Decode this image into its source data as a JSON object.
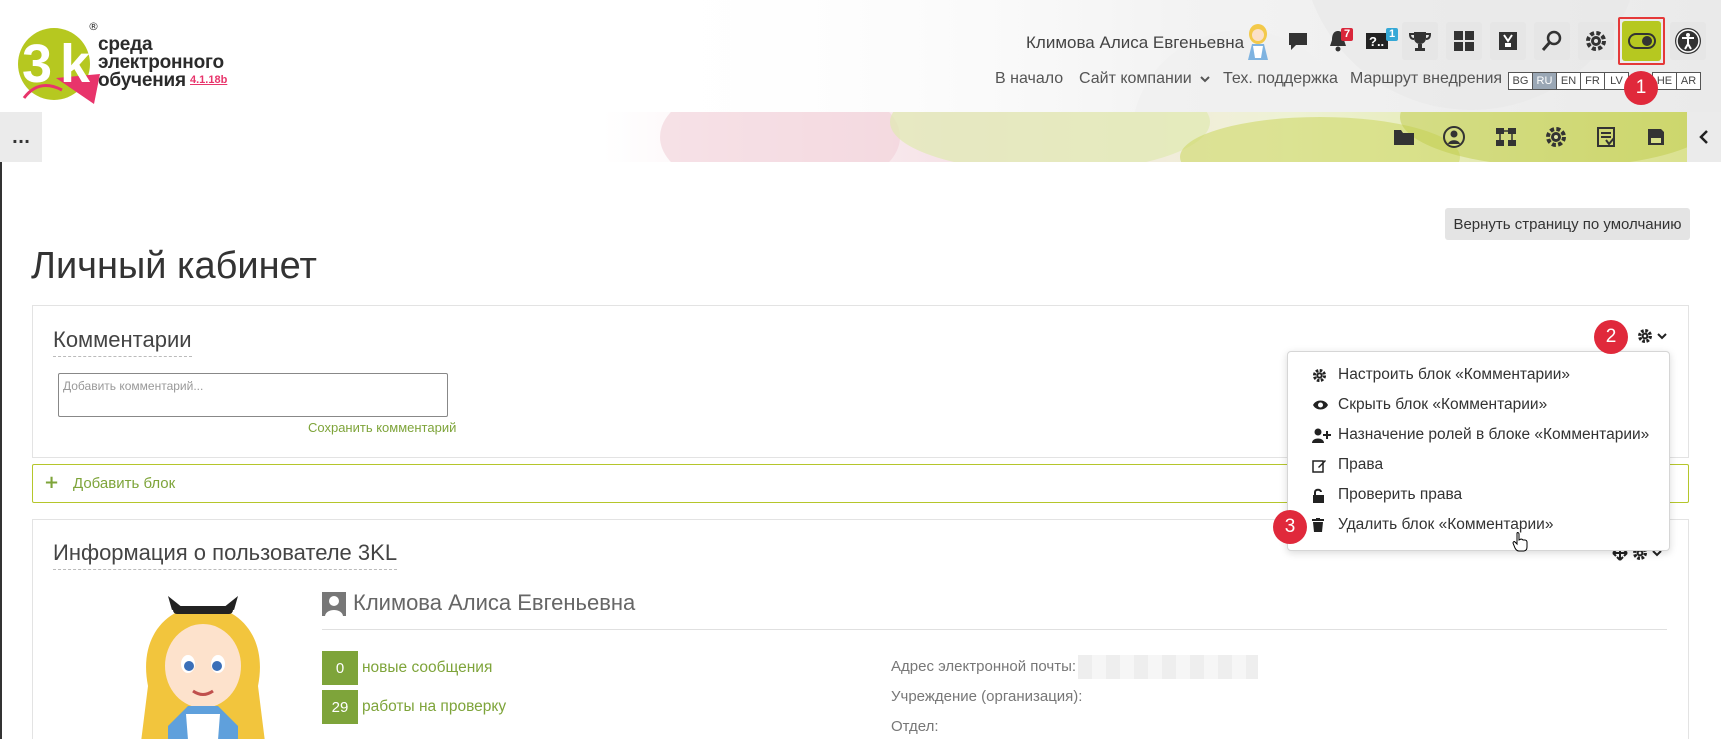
{
  "brand": {
    "line1": "среда",
    "line2": "электронного",
    "line3": "обучения",
    "version": "4.1.18b",
    "reg": "®"
  },
  "header": {
    "user_name": "Климова Алиса Евгеньевна",
    "notifications_count": "7",
    "help_count": "1"
  },
  "nav": {
    "home": "В начало",
    "company_site": "Сайт компании",
    "support": "Тех. поддержка",
    "route": "Маршрут внедрения"
  },
  "languages": [
    "BG",
    "RU",
    "EN",
    "FR",
    "LV",
    "HE",
    "AR"
  ],
  "active_language": "RU",
  "steps": {
    "one": "1",
    "two": "2",
    "three": "3"
  },
  "secondary_bar": {
    "more": "..."
  },
  "page": {
    "reset_button": "Вернуть страницу по умолчанию",
    "title": "Личный кабинет"
  },
  "comments_block": {
    "title": "Комментарии",
    "placeholder": "Добавить комментарий...",
    "save_link": "Сохранить комментарий"
  },
  "add_block": {
    "label": "Добавить блок"
  },
  "block_menu": {
    "configure": "Настроить блок «Комментарии»",
    "hide": "Скрыть блок «Комментарии»",
    "assign_roles": "Назначение ролей в блоке «Комментарии»",
    "permissions": "Права",
    "check_permissions": "Проверить права",
    "delete": "Удалить блок «Комментарии»"
  },
  "user_info_block": {
    "title": "Информация о пользователе 3KL",
    "full_name": "Климова Алиса Евгеньевна",
    "stats": [
      {
        "value": "0",
        "label": "новые сообщения"
      },
      {
        "value": "29",
        "label": "работы на проверку"
      }
    ],
    "fields": {
      "email": "Адрес электронной почты:",
      "organization": "Учреждение (организация):",
      "department": "Отдел:"
    }
  },
  "colors": {
    "accent_green": "#7ea43a",
    "toggle_active": "#b6c820",
    "step_red": "#e0293b",
    "brand_pink": "#e8346b"
  }
}
